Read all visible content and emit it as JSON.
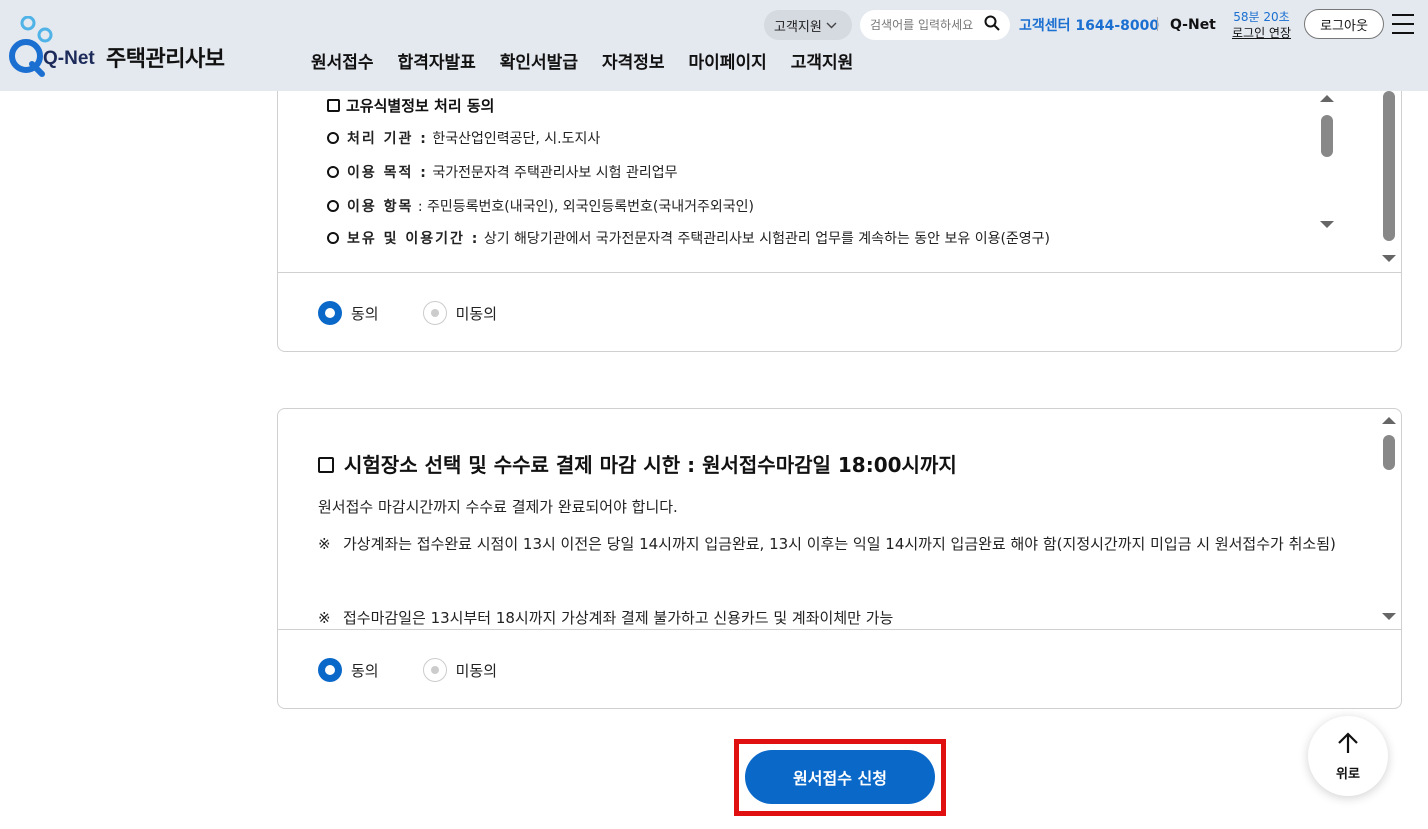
{
  "header": {
    "logo_text": "Q-Net",
    "site_name": "주택관리사보",
    "nav": [
      "원서접수",
      "합격자발표",
      "확인서발급",
      "자격정보",
      "마이페이지",
      "고객지원"
    ],
    "cs_dropdown_label": "고객지원",
    "search_placeholder": "검색어를 입력하세요",
    "cs_center": "고객센터 1644-8000",
    "qnet_link": "Q-Net",
    "session_remaining": "58분 20초",
    "session_extend": "로그인 연장",
    "logout": "로그아웃"
  },
  "privacy_section": {
    "title": "고유식별정보 처리 동의",
    "rows": [
      {
        "label": "처리 기관 :",
        "value": "한국산업인력공단, 시.도지사"
      },
      {
        "label": "이용 목적 :",
        "value": "국가전문자격 주택관리사보 시험 관리업무"
      },
      {
        "label": "이용 항목",
        "value": ": 주민등록번호(내국인), 외국인등록번호(국내거주외국인)"
      },
      {
        "label": "보유 및 이용기간 :",
        "value": "상기 해당기관에서 국가전문자격 주택관리사보 시험관리 업무를 계속하는 동안 보유 이용(준영구)"
      }
    ],
    "agree": "동의",
    "disagree": "미동의",
    "selected": "동의"
  },
  "deadline_section": {
    "title": "시험장소 선택 및 수수료 결제 마감 시한 : 원서접수마감일 18:00시까지",
    "paragraph": "원서접수 마감시간까지 수수료 결제가 완료되어야 합니다.",
    "note_mark": "※",
    "notes": [
      "가상계좌는 접수완료 시점이 13시 이전은 당일 14시까지 입금완료, 13시 이후는 익일 14시까지 입금완료 해야 함(지정시간까지 미입금 시 원서접수가 취소됨)",
      "접수마감일은 13시부터 18시까지 가상계좌 결제 불가하고 신용카드 및 계좌이체만 가능"
    ],
    "agree": "동의",
    "disagree": "미동의",
    "selected": "동의"
  },
  "submit_button": "원서접수 신청",
  "top_button": "위로",
  "colors": {
    "accent": "#0a68c9",
    "header_bg": "#e4e8ef",
    "highlight_frame": "#e01010",
    "link_blue": "#1a6fd1"
  }
}
